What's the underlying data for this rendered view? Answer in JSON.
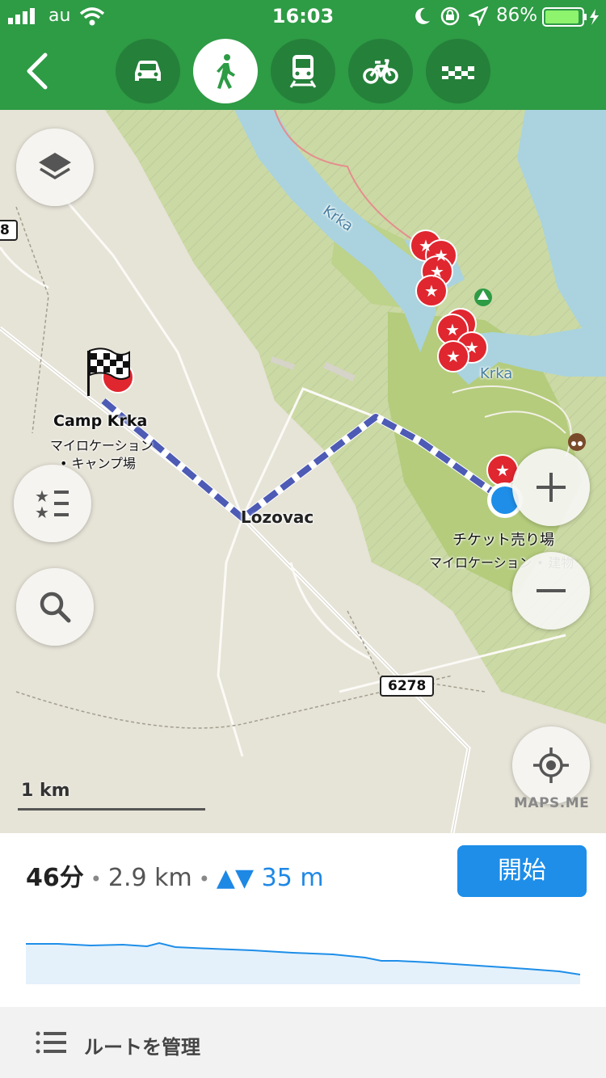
{
  "status_bar": {
    "carrier": "au",
    "time": "16:03",
    "battery": "86%"
  },
  "header": {
    "back_icon": "chevron-left-icon",
    "modes": [
      {
        "name": "car",
        "icon": "car-icon",
        "active": false
      },
      {
        "name": "walk",
        "icon": "pedestrian-icon",
        "active": true
      },
      {
        "name": "transit",
        "icon": "train-icon",
        "active": false
      },
      {
        "name": "bicycle",
        "icon": "bicycle-icon",
        "active": false
      },
      {
        "name": "taxi",
        "icon": "taxi-icon",
        "active": false
      }
    ],
    "accent_color": "#2e9b45"
  },
  "map": {
    "labels": {
      "river_1": "Krka",
      "river_2": "Krka",
      "start_place_name": "Camp Krka",
      "start_place_sub1": "マイロケーション",
      "start_place_sub2": "• キャンプ場",
      "town": "Lozovac",
      "dest_place_name": "チケット売り場",
      "dest_place_sub": "マイロケーション • 建物",
      "road_shield_1": "8",
      "road_shield_2": "6278"
    },
    "scale": "1 km",
    "brand": "MAPS.ME",
    "route_color": "#4d5bb5",
    "poi_color": "#e0262f"
  },
  "route": {
    "time": "46分",
    "distance": "2.9 km",
    "elevation_icon": "▲▼",
    "elevation": "35 m",
    "start_button": "開始"
  },
  "bottom": {
    "manage_label": "ルートを管理"
  }
}
